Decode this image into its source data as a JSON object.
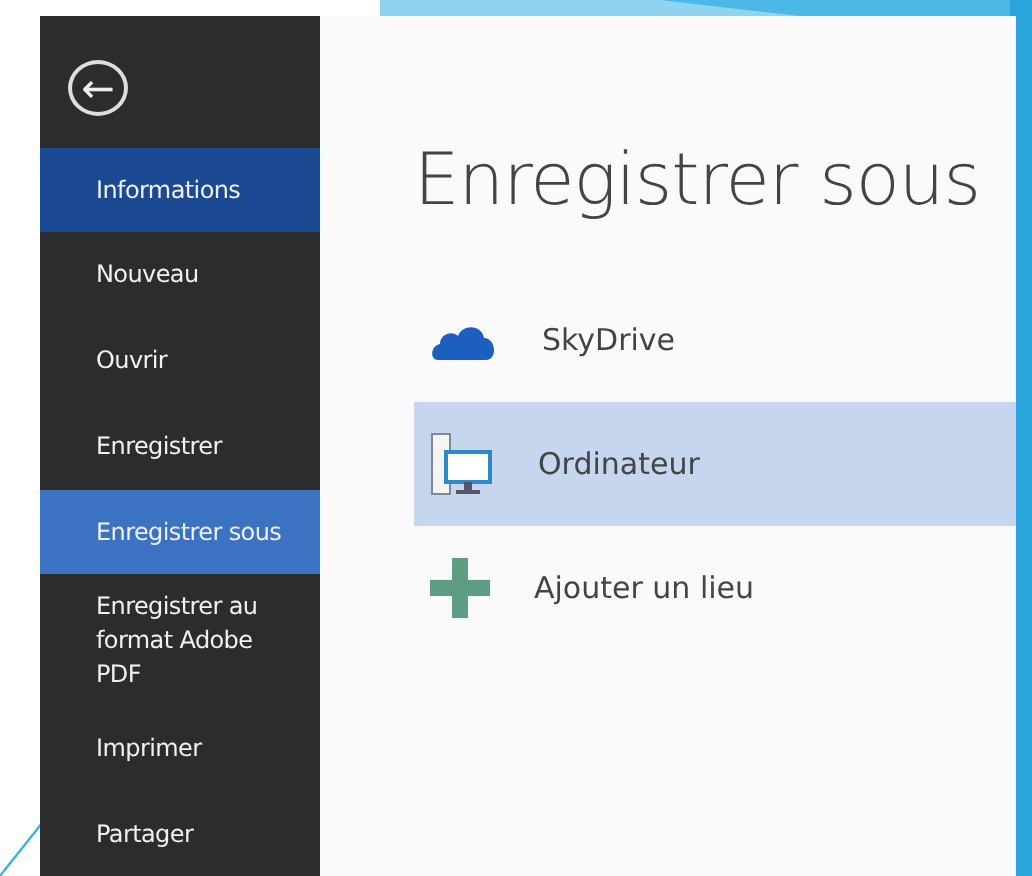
{
  "sidebar": {
    "back_button": "←",
    "items": [
      {
        "label": "Informations",
        "selected": false,
        "hovered": true
      },
      {
        "label": "Nouveau",
        "selected": false,
        "hovered": false
      },
      {
        "label": "Ouvrir",
        "selected": false,
        "hovered": false
      },
      {
        "label": "Enregistrer",
        "selected": false,
        "hovered": false
      },
      {
        "label": "Enregistrer sous",
        "selected": true,
        "hovered": false
      },
      {
        "label": "Enregistrer au format Adobe PDF",
        "selected": false,
        "hovered": false
      },
      {
        "label": "Imprimer",
        "selected": false,
        "hovered": false
      },
      {
        "label": "Partager",
        "selected": false,
        "hovered": false
      }
    ]
  },
  "main": {
    "title": "Enregistrer sous",
    "locations": [
      {
        "kind": "cloud",
        "label": "SkyDrive",
        "selected": false
      },
      {
        "kind": "computer",
        "label": "Ordinateur",
        "selected": true
      },
      {
        "kind": "add",
        "label": "Ajouter un lieu",
        "selected": false
      }
    ]
  }
}
